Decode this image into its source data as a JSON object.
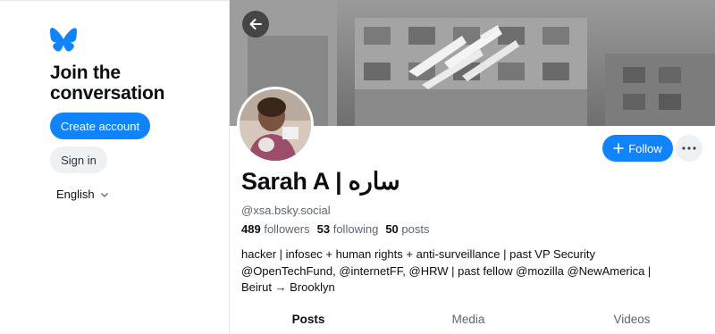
{
  "sidebar": {
    "logo_icon": "butterfly-icon",
    "heading": "Join the conversation",
    "create_account_label": "Create account",
    "sign_in_label": "Sign in",
    "language": "English",
    "brand_color": "#1083fe"
  },
  "profile": {
    "back_icon": "arrow-left-icon",
    "display_name": "Sarah A | ساره",
    "handle": "@xsa.bsky.social",
    "followers_count": "489",
    "followers_label": "followers",
    "following_count": "53",
    "following_label": "following",
    "posts_count": "50",
    "posts_label": "posts",
    "bio_lines": [
      "hacker | infosec + human rights + anti-surveillance | past VP Security",
      "@OpenTechFund, @internetFF, @HRW | past fellow @mozilla @NewAmerica |",
      "Beirut → Brooklyn"
    ],
    "follow_label": "Follow",
    "more_icon": "ellipsis-icon"
  },
  "tabs": [
    {
      "label": "Posts",
      "active": true
    },
    {
      "label": "Media",
      "active": false
    },
    {
      "label": "Videos",
      "active": false
    }
  ]
}
